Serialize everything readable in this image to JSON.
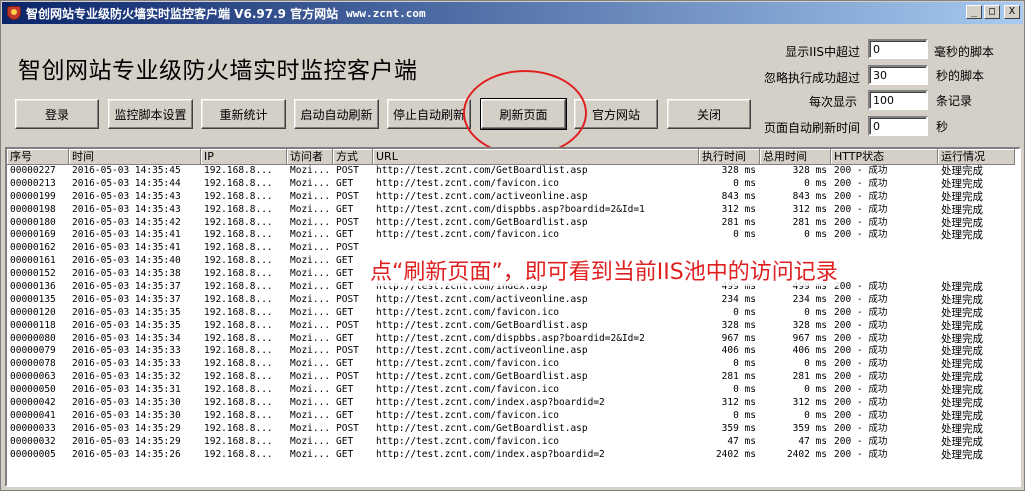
{
  "window": {
    "title": "智创网站专业级防火墙实时监控客户端 V6.97.9 官方网站",
    "url_text": "www.zcnt.com",
    "minimize": "_",
    "maximize": "□",
    "close": "X"
  },
  "header": {
    "app_title": "智创网站专业级防火墙实时监控客户端"
  },
  "toolbar": {
    "login": "登录",
    "script_settings": "监控脚本设置",
    "restat": "重新统计",
    "start_auto_refresh": "启动自动刷新",
    "stop_auto_refresh": "停止自动刷新",
    "refresh_page": "刷新页面",
    "official_site": "官方网站",
    "close": "关闭"
  },
  "options": {
    "show_iis_over_label": "显示IIS中超过",
    "show_iis_over_value": "0",
    "show_iis_over_unit": "毫秒的脚本",
    "ignore_success_label": "忽略执行成功超过",
    "ignore_success_value": "30",
    "ignore_success_unit": "秒的脚本",
    "each_show_label": "每次显示",
    "each_show_value": "100",
    "each_show_unit": "条记录",
    "auto_refresh_label": "页面自动刷新时间",
    "auto_refresh_value": "0",
    "auto_refresh_unit": "秒"
  },
  "table": {
    "columns": [
      "序号",
      "时间",
      "IP",
      "访问者",
      "方式",
      "URL",
      "执行时间",
      "总用时间",
      "HTTP状态",
      "运行情况"
    ],
    "rows": [
      [
        "00000227",
        "2016-05-03 14:35:45",
        "192.168.8...",
        "Mozi...",
        "POST",
        "http://test.zcnt.com/GetBoardlist.asp",
        "328 ms",
        "328 ms",
        "200 - 成功",
        "处理完成"
      ],
      [
        "00000213",
        "2016-05-03 14:35:44",
        "192.168.8...",
        "Mozi...",
        "GET",
        "http://test.zcnt.com/favicon.ico",
        "0 ms",
        "0 ms",
        "200 - 成功",
        "处理完成"
      ],
      [
        "00000199",
        "2016-05-03 14:35:43",
        "192.168.8...",
        "Mozi...",
        "POST",
        "http://test.zcnt.com/activeonline.asp",
        "843 ms",
        "843 ms",
        "200 - 成功",
        "处理完成"
      ],
      [
        "00000198",
        "2016-05-03 14:35:43",
        "192.168.8...",
        "Mozi...",
        "GET",
        "http://test.zcnt.com/dispbbs.asp?boardid=2&Id=1",
        "312 ms",
        "312 ms",
        "200 - 成功",
        "处理完成"
      ],
      [
        "00000180",
        "2016-05-03 14:35:42",
        "192.168.8...",
        "Mozi...",
        "POST",
        "http://test.zcnt.com/GetBoardlist.asp",
        "281 ms",
        "281 ms",
        "200 - 成功",
        "处理完成"
      ],
      [
        "00000169",
        "2016-05-03 14:35:41",
        "192.168.8...",
        "Mozi...",
        "GET",
        "http://test.zcnt.com/favicon.ico",
        "0 ms",
        "0 ms",
        "200 - 成功",
        "处理完成"
      ],
      [
        "00000162",
        "2016-05-03 14:35:41",
        "192.168.8...",
        "Mozi...",
        "POST",
        "",
        "",
        "",
        "",
        ""
      ],
      [
        "00000161",
        "2016-05-03 14:35:40",
        "192.168.8...",
        "Mozi...",
        "GET",
        "",
        "",
        "",
        "",
        ""
      ],
      [
        "00000152",
        "2016-05-03 14:35:38",
        "192.168.8...",
        "Mozi...",
        "GET",
        "",
        "",
        "",
        "",
        ""
      ],
      [
        "00000136",
        "2016-05-03 14:35:37",
        "192.168.8...",
        "Mozi...",
        "GET",
        "http://test.zcnt.com/index.asp",
        "499 ms",
        "499 ms",
        "200 - 成功",
        "处理完成"
      ],
      [
        "00000135",
        "2016-05-03 14:35:37",
        "192.168.8...",
        "Mozi...",
        "POST",
        "http://test.zcnt.com/activeonline.asp",
        "234 ms",
        "234 ms",
        "200 - 成功",
        "处理完成"
      ],
      [
        "00000120",
        "2016-05-03 14:35:35",
        "192.168.8...",
        "Mozi...",
        "GET",
        "http://test.zcnt.com/favicon.ico",
        "0 ms",
        "0 ms",
        "200 - 成功",
        "处理完成"
      ],
      [
        "00000118",
        "2016-05-03 14:35:35",
        "192.168.8...",
        "Mozi...",
        "POST",
        "http://test.zcnt.com/GetBoardlist.asp",
        "328 ms",
        "328 ms",
        "200 - 成功",
        "处理完成"
      ],
      [
        "00000080",
        "2016-05-03 14:35:34",
        "192.168.8...",
        "Mozi...",
        "GET",
        "http://test.zcnt.com/dispbbs.asp?boardid=2&Id=2",
        "967 ms",
        "967 ms",
        "200 - 成功",
        "处理完成"
      ],
      [
        "00000079",
        "2016-05-03 14:35:33",
        "192.168.8...",
        "Mozi...",
        "POST",
        "http://test.zcnt.com/activeonline.asp",
        "406 ms",
        "406 ms",
        "200 - 成功",
        "处理完成"
      ],
      [
        "00000078",
        "2016-05-03 14:35:33",
        "192.168.8...",
        "Mozi...",
        "GET",
        "http://test.zcnt.com/favicon.ico",
        "0 ms",
        "0 ms",
        "200 - 成功",
        "处理完成"
      ],
      [
        "00000063",
        "2016-05-03 14:35:32",
        "192.168.8...",
        "Mozi...",
        "POST",
        "http://test.zcnt.com/GetBoardlist.asp",
        "281 ms",
        "281 ms",
        "200 - 成功",
        "处理完成"
      ],
      [
        "00000050",
        "2016-05-03 14:35:31",
        "192.168.8...",
        "Mozi...",
        "GET",
        "http://test.zcnt.com/favicon.ico",
        "0 ms",
        "0 ms",
        "200 - 成功",
        "处理完成"
      ],
      [
        "00000042",
        "2016-05-03 14:35:30",
        "192.168.8...",
        "Mozi...",
        "GET",
        "http://test.zcnt.com/index.asp?boardid=2",
        "312 ms",
        "312 ms",
        "200 - 成功",
        "处理完成"
      ],
      [
        "00000041",
        "2016-05-03 14:35:30",
        "192.168.8...",
        "Mozi...",
        "GET",
        "http://test.zcnt.com/favicon.ico",
        "0 ms",
        "0 ms",
        "200 - 成功",
        "处理完成"
      ],
      [
        "00000033",
        "2016-05-03 14:35:29",
        "192.168.8...",
        "Mozi...",
        "POST",
        "http://test.zcnt.com/GetBoardlist.asp",
        "359 ms",
        "359 ms",
        "200 - 成功",
        "处理完成"
      ],
      [
        "00000032",
        "2016-05-03 14:35:29",
        "192.168.8...",
        "Mozi...",
        "GET",
        "http://test.zcnt.com/favicon.ico",
        "47 ms",
        "47 ms",
        "200 - 成功",
        "处理完成"
      ],
      [
        "00000005",
        "2016-05-03 14:35:26",
        "192.168.8...",
        "Mozi...",
        "GET",
        "http://test.zcnt.com/index.asp?boardid=2",
        "2402 ms",
        "2402 ms",
        "200 - 成功",
        "处理完成"
      ]
    ]
  },
  "annotation": {
    "text": "点“刷新页面”，即可看到当前IIS池中的访问记录"
  },
  "colors": {
    "highlight": "#e02020",
    "titlebar_start": "#0a246a",
    "titlebar_end": "#a6caf0",
    "face": "#d4d0c8"
  }
}
